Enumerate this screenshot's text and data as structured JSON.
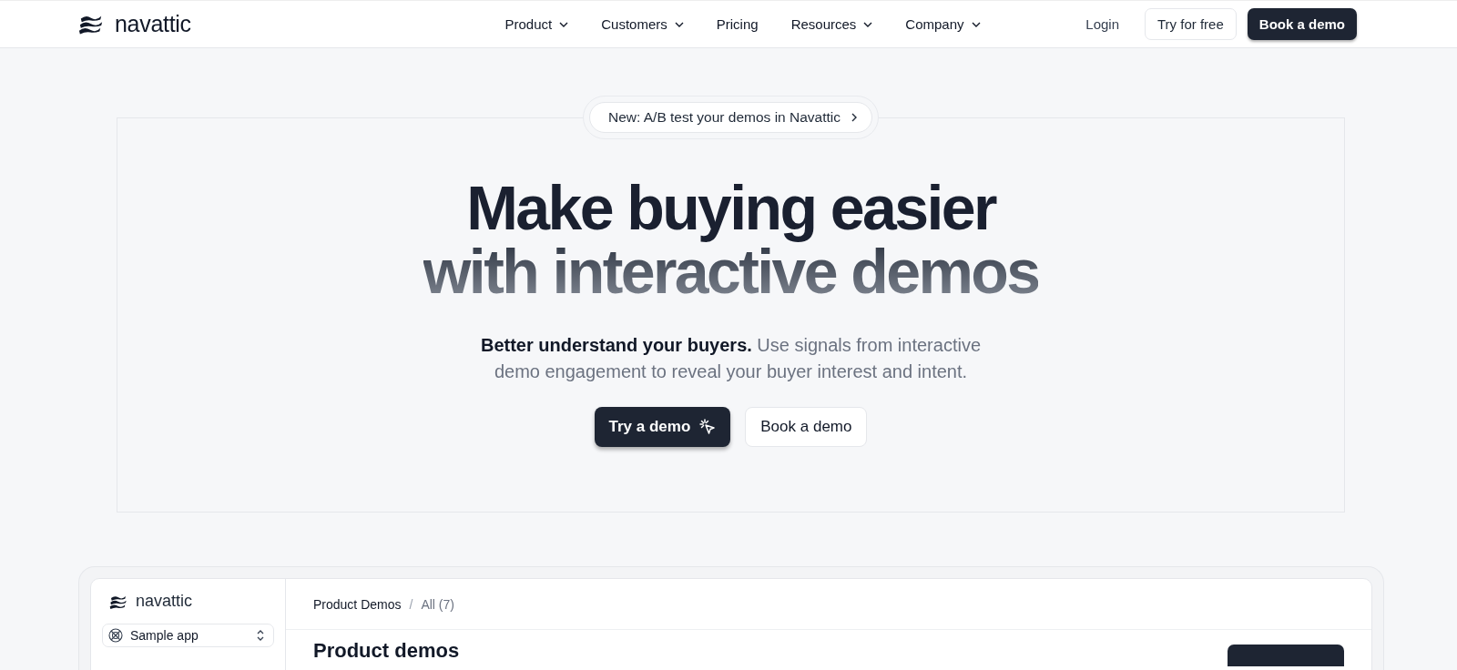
{
  "header": {
    "logo": "navattic",
    "nav": [
      {
        "label": "Product",
        "dropdown": true
      },
      {
        "label": "Customers",
        "dropdown": true
      },
      {
        "label": "Pricing",
        "dropdown": false
      },
      {
        "label": "Resources",
        "dropdown": true
      },
      {
        "label": "Company",
        "dropdown": true
      }
    ],
    "login": "Login",
    "try_free": "Try for free",
    "book_demo": "Book a demo"
  },
  "hero": {
    "badge": "New: A/B test your demos in Navattic",
    "headline": [
      "Make buying easier",
      "with interactive demos"
    ],
    "subtitle": "**Better understand your buyers.** Use signals from interactive demo engagement to reveal your buyer interest and intent.",
    "buttons": [
      {
        "label": "Try a demo",
        "kind": "primary"
      },
      {
        "label": "Book a demo",
        "kind": "secondary"
      }
    ]
  },
  "app_preview": {
    "logo": "navattic",
    "workspace": "Sample app",
    "breadcrumb": [
      "Product Demos",
      "/",
      "All (7)"
    ],
    "heading": "Product demos"
  }
}
